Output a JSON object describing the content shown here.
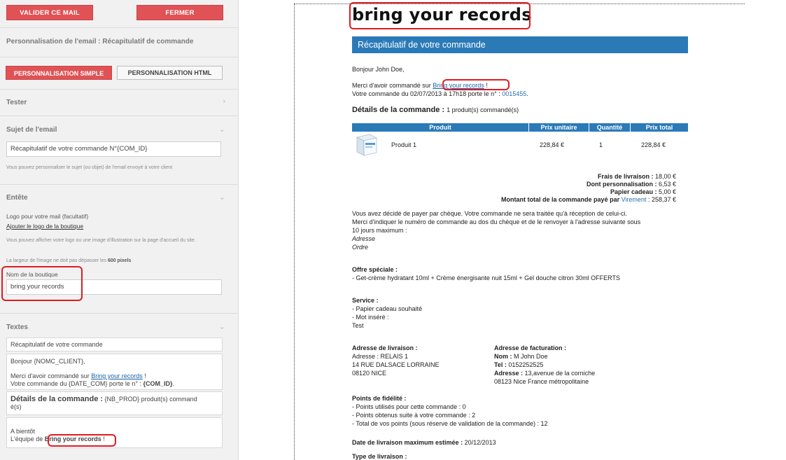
{
  "toolbar": {
    "validate_label": "VALIDER CE MAIL",
    "close_label": "FERMER"
  },
  "panel": {
    "title": "Personnalisation de l'email : Récapitulatif de commande",
    "mode_simple": "PERSONNALISATION SIMPLE",
    "mode_html": "PERSONNALISATION HTML",
    "tester_label": "Tester",
    "subject": {
      "label": "Sujet de l'email",
      "value": "Récapitulatif de votre commande N°{COM_ID}",
      "help": "Vous pouvez personnaliser le sujet (ou objet) de l'email envoyé à votre client"
    },
    "header": {
      "label": "Entête",
      "logo_label": "Logo pour votre mail (facultatif)",
      "logo_link": "Ajouter le logo de la boutique",
      "help1": "Vous pouvez afficher votre logo ou une image d'illustration sur la page d'accueil du site.",
      "help2_prefix": "La largeur de l'image ne doit pas dépasser les",
      "help2_bold": "600 pixels",
      "shop_name_label": "Nom de la boutique",
      "shop_name_value": "bring your records"
    },
    "texts": {
      "label": "Textes",
      "t1": "Récapitulatif de votre commande",
      "t2_l1": "Bonjour {NOMC_CLIENT},",
      "t2_l2a": "Merci d'avoir commandé sur ",
      "t2_link": "Bring your records",
      "t2_l2b": " !",
      "t2_l3a": "Votre commande du {DATE_COM} porte le n° : ",
      "t2_l3b": "{COM_ID}",
      "t2_l3c": ".",
      "t3_bold": "Détails de la commande :",
      "t3_rest": " {NB_PROD} produit(s) command",
      "t3_rest2": "é(s)",
      "t4_l1": "A bientôt",
      "t4_l2a": "L'équipe de ",
      "t4_l2b": "Bring your records",
      "t4_l2c": " !"
    }
  },
  "preview": {
    "shop_title": "bring your records",
    "banner": "Récapitulatif de votre commande",
    "greeting": "Bonjour John Doe,",
    "thanks_a": "Merci d'avoir commandé sur ",
    "thanks_link": "Bring your records",
    "thanks_b": " !",
    "order_a": "Votre commande du 02/07/2013 à 17h18 porte le n° : ",
    "order_num": "0015455",
    "order_b": ".",
    "details_bold": "Détails de la commande : ",
    "details_rest": "1 produit(s) commandé(s)",
    "table": {
      "headers": [
        "Produit",
        "Prix unitaire",
        "Quantité",
        "Prix total"
      ],
      "row": [
        "Produit 1",
        "228,84 €",
        "1",
        "228,84 €"
      ]
    },
    "totals": [
      {
        "label": "Frais de livraison : ",
        "value": "18,00 €"
      },
      {
        "label": "Dont personnalisation : ",
        "value": "6,53 €"
      },
      {
        "label": "Papier cadeau : ",
        "value": "5,00 €"
      }
    ],
    "total_paid_label": "Montant total de la commande payé par ",
    "total_paid_method": "Virement",
    "total_paid_value": " : 258,37 €",
    "payment": [
      "Vous avez décidé de payer par chèque. Votre commande ne sera traitée qu'à réception de celui-ci.",
      "Merci d'indiquer le numéro de commande au dos du chèque et de le renvoyer à l'adresse suivante sous",
      "10 jours maximum :"
    ],
    "address_it": "Adresse",
    "order_it": "Ordre",
    "offer_title": "Offre spéciale :",
    "offer_text": "- Get-crème hydratant 10ml + Crème énergisante nuit 15ml + Gel douche citron 30ml OFFERTS",
    "service_title": "Service :",
    "service_lines": [
      "- Papier cadeau souhaité",
      "- Mot inséré :",
      "Test"
    ],
    "delivery_title": "Adresse de livraison :",
    "delivery_lines": [
      "Adresse : RELAIS 1",
      "14 RUE DALSACE LORRAINE",
      "08120 NICE"
    ],
    "billing_title": "Adresse de facturation :",
    "billing_name_label": "Nom : ",
    "billing_name": "M John Doe",
    "billing_tel_label": "Tel : ",
    "billing_tel": "0152252525",
    "billing_addr_label": "Adresse : ",
    "billing_addr": "13,avenue de la corniche",
    "billing_city": "08123 Nice France métropolitaine",
    "loyalty_title": "Points de fidélité :",
    "loyalty_lines": [
      "- Points utilisés pour cette commande : 0",
      "- Points obtenus suite à votre commande : 2",
      "- Total de vos points (sous réserve de validation de la commande) : 12"
    ],
    "max_date_label": "Date de livraison maximum estimée : ",
    "max_date": "20/12/2013",
    "delivery_type_label": "Type de livraison :"
  },
  "icons": {
    "chevron": "chevron-down-icon",
    "chevron_right": "chevron-right-icon",
    "product": "product-box-icon"
  },
  "colors": {
    "accent_red": "#e05255",
    "banner_blue": "#2a7ab8",
    "highlight": "#e01b22"
  }
}
